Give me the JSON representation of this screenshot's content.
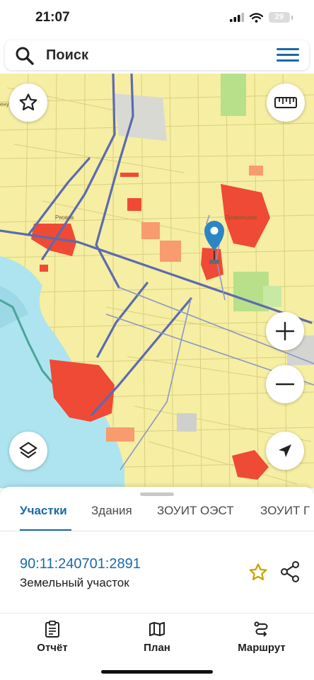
{
  "status_bar": {
    "time": "21:07",
    "battery": "29"
  },
  "search": {
    "placeholder": "Поиск"
  },
  "map": {
    "labels": {
      "village_1": "Ряовка",
      "village_2": "Привольное",
      "road_edge": "енуз"
    },
    "controls": [
      "favorite",
      "ruler",
      "zoom-in",
      "zoom-out",
      "layers",
      "locate"
    ]
  },
  "sheet": {
    "tabs": [
      {
        "label": "Участки",
        "active": true
      },
      {
        "label": "Здания",
        "active": false
      },
      {
        "label": "ЗОУИТ ОЭСТ",
        "active": false
      },
      {
        "label": "ЗОУИТ Г",
        "active": false
      }
    ],
    "parcel": {
      "cadastral_number": "90:11:240701:2891",
      "type": "Земельный участок"
    }
  },
  "bottom_nav": [
    {
      "label": "Отчёт",
      "icon": "clipboard-icon"
    },
    {
      "label": "План",
      "icon": "map-icon"
    },
    {
      "label": "Маршрут",
      "icon": "route-icon"
    }
  ],
  "colors": {
    "accent": "#1a6aa8",
    "map_yellow": "#f6eea2",
    "water": "#aee4ef",
    "settlement": "#ef4a35",
    "star": "#c9a300"
  }
}
